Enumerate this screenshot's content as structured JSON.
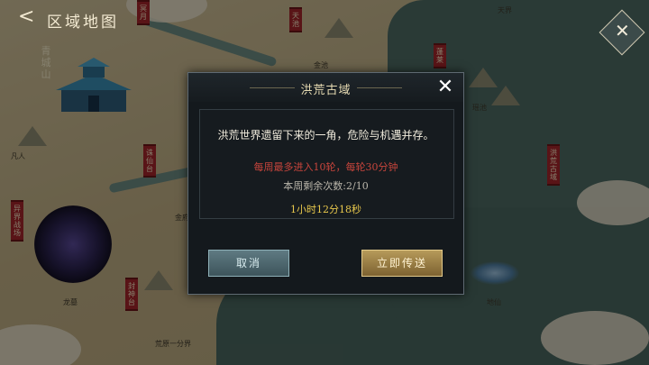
{
  "header": {
    "back_symbol": "<",
    "title": "区域地图"
  },
  "map_labels": {
    "qingcheng": "青城山",
    "tianchi": "天池",
    "yuanyang": "冥月",
    "honghuang": "洪荒古域",
    "yijie": "异界战场",
    "tianyao": "诛仙台",
    "jieshen": "封神台",
    "penglai": "蓬莱",
    "small1": "金池",
    "small2": "凡人",
    "small3": "瑶池",
    "small4": "地仙",
    "small5": "天界",
    "small6": "荒原一分界",
    "small7": "龙墓",
    "small8": "金府"
  },
  "dialog": {
    "title": "洪荒古域",
    "close_symbol": "✕",
    "description": "洪荒世界遗留下来的一角，危险与机遇并存。",
    "limit": "每周最多进入10轮，每轮30分钟",
    "remaining": "本周剩余次数:2/10",
    "timer": "1小时12分18秒",
    "cancel_label": "取消",
    "teleport_label": "立即传送"
  },
  "colors": {
    "limit": "#c8453c",
    "timer": "#e8c84c",
    "banner": "#a2262b"
  },
  "icons": {
    "corner": "close-icon",
    "back": "back-arrow-icon"
  }
}
